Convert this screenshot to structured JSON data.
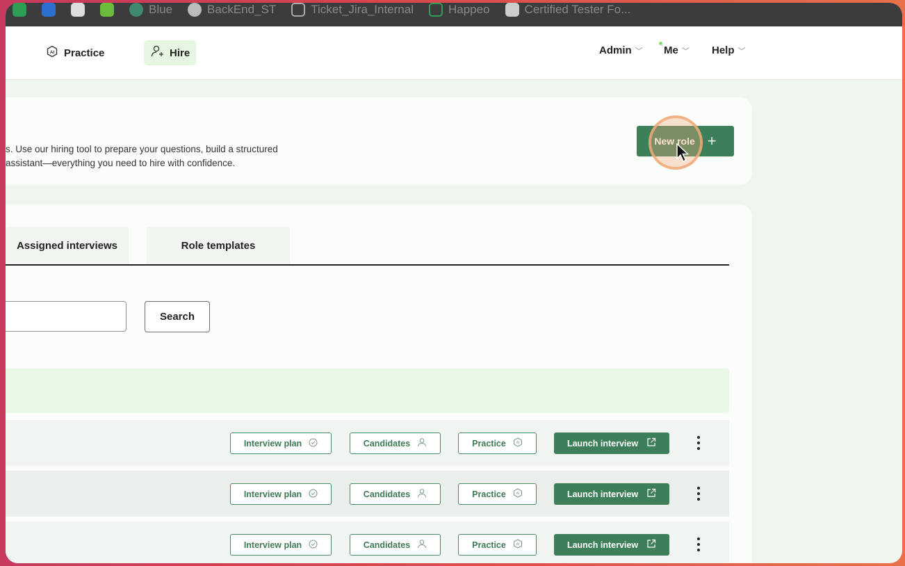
{
  "bookmarks": [
    {
      "label": "",
      "icon": "green-bookmark-icon",
      "color": "#2f9e55"
    },
    {
      "label": "",
      "icon": "blue-cube-icon",
      "color": "#2c6fd1"
    },
    {
      "label": "",
      "icon": "white-logo-icon",
      "color": "#dddddd"
    },
    {
      "label": "",
      "icon": "owl-icon",
      "color": "#6cbb3c"
    },
    {
      "label": "Blue",
      "icon": "b-icon",
      "color": "#3f8a6f"
    },
    {
      "label": "BackEnd_ST",
      "icon": "github-icon",
      "color": "#bbbbbb"
    },
    {
      "label": "Ticket_Jira_Internal",
      "icon": "folder-icon",
      "color": "#aaaaaa"
    },
    {
      "label": "Happeo",
      "icon": "happeo-icon",
      "color": "#2f9e55"
    },
    {
      "label": "Certified Tester Fo...",
      "icon": "istqb-icon",
      "color": "#cccccc"
    }
  ],
  "nav": {
    "practice": "Practice",
    "hire": "Hire",
    "admin": "Admin",
    "me": "Me",
    "help": "Help"
  },
  "intro": {
    "line1": "s. Use our hiring tool to prepare your questions, build a structured",
    "line2": "assistant—everything you need to hire with confidence.",
    "new_role": "New role"
  },
  "tabs": {
    "assigned": "Assigned interviews",
    "templates": "Role templates"
  },
  "search": {
    "placeholder": "",
    "button": "Search"
  },
  "row_actions": {
    "interview_plan": "Interview plan",
    "candidates": "Candidates",
    "practice": "Practice",
    "launch": "Launch interview"
  },
  "colors": {
    "accent": "#3d7f58",
    "highlight": "#e6f6e1"
  }
}
